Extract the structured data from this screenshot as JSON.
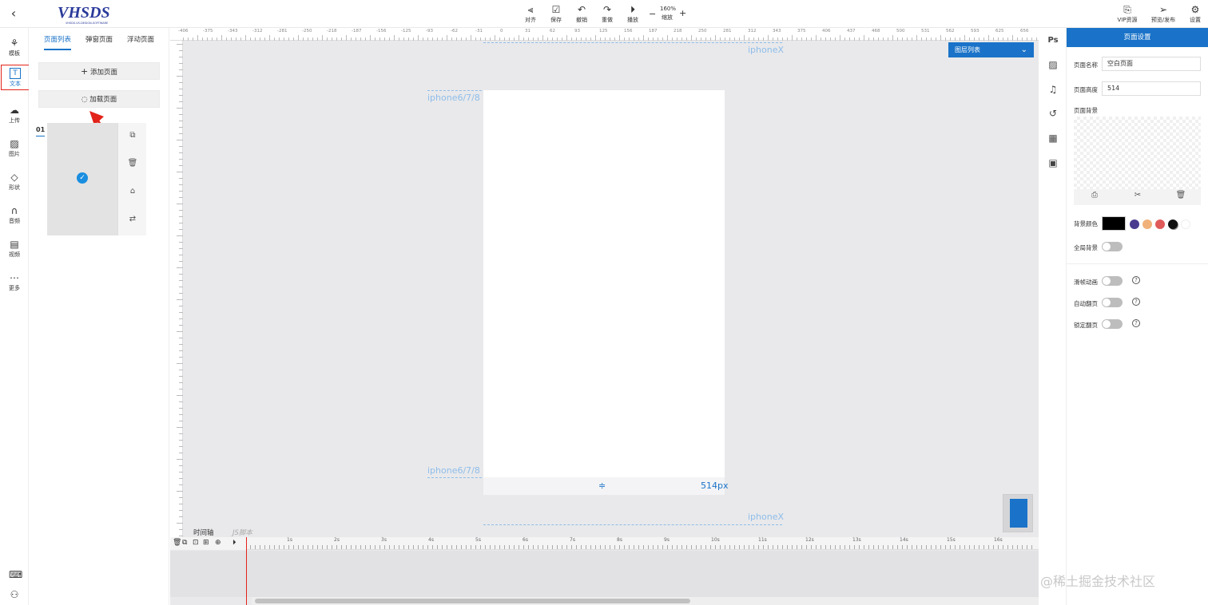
{
  "header": {
    "logo_text": "VHSDS",
    "logo_sub": "VHSDS-VS-DESIGN-SOFTWARE",
    "toolbar": [
      {
        "label": "对齐",
        "icon": "align-icon"
      },
      {
        "label": "保存",
        "icon": "save-icon"
      },
      {
        "label": "撤销",
        "icon": "undo-icon"
      },
      {
        "label": "重做",
        "icon": "redo-icon"
      },
      {
        "label": "播放",
        "icon": "play-icon"
      }
    ],
    "zoom": {
      "value": "160%",
      "label": "缩放",
      "minus": "−",
      "plus": "+"
    },
    "right_actions": [
      {
        "label": "VIP资源",
        "icon": "vip-icon"
      },
      {
        "label": "预览/发布",
        "icon": "send-icon"
      },
      {
        "label": "设置",
        "icon": "gear-icon"
      }
    ]
  },
  "sidebar": {
    "items": [
      {
        "label": "模板",
        "icon": "template-icon"
      },
      {
        "label": "文本",
        "icon": "text-icon",
        "active": true
      },
      {
        "label": "上传",
        "icon": "upload-icon"
      },
      {
        "label": "图片",
        "icon": "image-icon"
      },
      {
        "label": "形状",
        "icon": "shape-icon"
      },
      {
        "label": "音频",
        "icon": "headphone-icon"
      },
      {
        "label": "视频",
        "icon": "video-icon"
      },
      {
        "label": "更多",
        "icon": "more-icon"
      }
    ]
  },
  "pages": {
    "tabs": [
      "页面列表",
      "弹窗页面",
      "浮动页面"
    ],
    "add_label": "添加页面",
    "load_label": "加载页面",
    "page_number": "01"
  },
  "canvas": {
    "ruler_top": [
      "-406",
      "-375",
      "-343",
      "-312",
      "-281",
      "-250",
      "-218",
      "-187",
      "-156",
      "-125",
      "-93",
      "-62",
      "-31",
      "0",
      "31",
      "62",
      "93",
      "125",
      "156",
      "187",
      "218",
      "250",
      "281",
      "312",
      "343",
      "375",
      "406",
      "437",
      "468",
      "500",
      "531",
      "562",
      "593",
      "625",
      "656",
      "687",
      "718"
    ],
    "guide_iphonex": "iphoneX",
    "guide_iphone678": "iphone6/7/8",
    "page_height_label": "514px",
    "layer_list_label": "图层列表"
  },
  "timeline": {
    "tabs": [
      "时间轴",
      "JS脚本"
    ],
    "ticks": [
      "1s",
      "2s",
      "3s",
      "4s",
      "5s",
      "6s",
      "7s",
      "8s",
      "9s",
      "10s",
      "11s",
      "12s",
      "13s",
      "14s",
      "15s",
      "16s"
    ]
  },
  "settings": {
    "title": "页面设置",
    "name_label": "页面名称",
    "name_value": "空白页面",
    "height_label": "页面高度",
    "height_value": "514",
    "bg_label": "页面背景",
    "bg_color_label": "背景颜色",
    "colors": [
      "#000000",
      "#4a3b8f",
      "#f0b27a",
      "#e05a5a",
      "#111111",
      "#ffffff"
    ],
    "global_bg_label": "全局背景",
    "slide_anim_label": "滑帧动画",
    "auto_flip_label": "自动翻页",
    "lock_flip_label": "锁定翻页"
  },
  "watermark": "@稀土掘金技术社区"
}
